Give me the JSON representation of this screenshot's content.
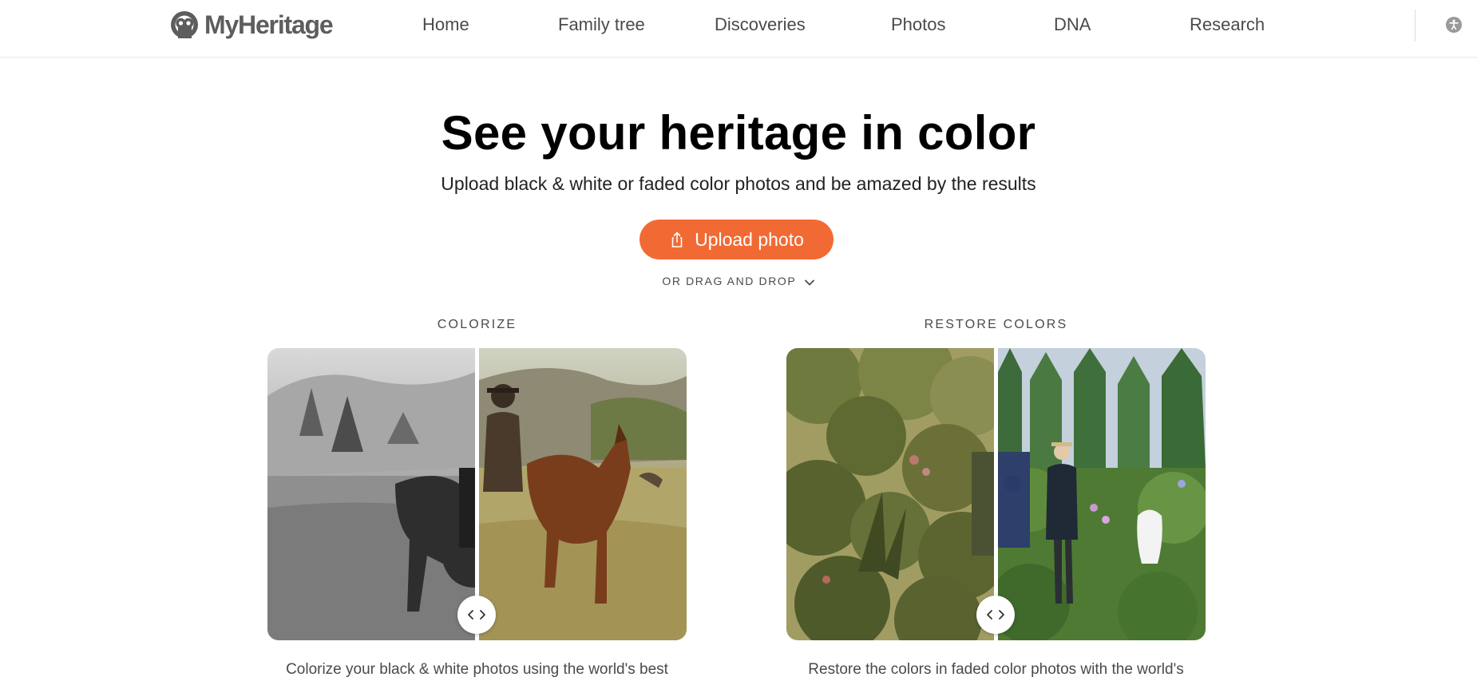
{
  "header": {
    "logo_text": "MyHeritage",
    "nav": [
      {
        "label": "Home"
      },
      {
        "label": "Family tree"
      },
      {
        "label": "Discoveries"
      },
      {
        "label": "Photos"
      },
      {
        "label": "DNA"
      },
      {
        "label": "Research"
      }
    ],
    "accessibility_icon": "accessibility-icon"
  },
  "hero": {
    "title": "See your heritage in color",
    "subtitle": "Upload black & white or faded color photos and be amazed by the results",
    "upload_button": "Upload photo",
    "upload_icon": "share-upload-icon",
    "drag_text": "OR DRAG AND DROP",
    "drag_icon": "chevron-down-icon"
  },
  "features": [
    {
      "label": "COLORIZE",
      "description": "Colorize your black & white photos using the world's best",
      "handle_icon": "compare-arrows-icon"
    },
    {
      "label": "RESTORE COLORS",
      "description": "Restore the colors in faded color photos with the world's",
      "handle_icon": "compare-arrows-icon"
    }
  ],
  "colors": {
    "accent": "#f26a33",
    "text": "#4a4a4a",
    "title": "#000000"
  }
}
